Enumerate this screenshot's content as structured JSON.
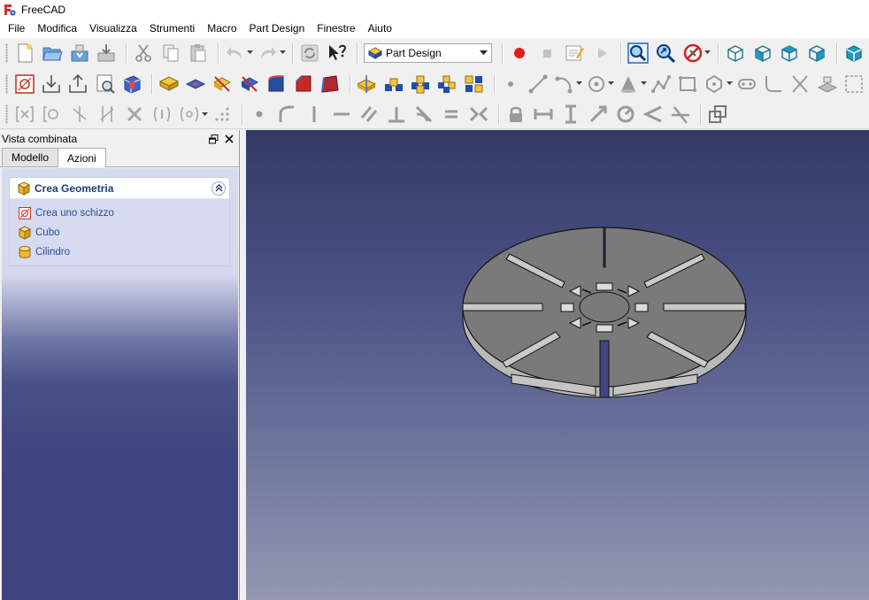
{
  "window": {
    "title": "FreeCAD"
  },
  "menu": [
    "File",
    "Modifica",
    "Visualizza",
    "Strumenti",
    "Macro",
    "Part Design",
    "Finestre",
    "Aiuto"
  ],
  "workbench": {
    "selected": "Part Design"
  },
  "combo_view": {
    "title": "Vista combinata",
    "tabs": [
      "Modello",
      "Azioni"
    ],
    "active_tab": "Azioni"
  },
  "tasks": {
    "group_title": "Crea Geometria",
    "items": [
      "Crea uno schizzo",
      "Cubo",
      "Cilindro"
    ]
  },
  "colors": {
    "accent": "#1f3c78",
    "viewport_top": "#333a66",
    "viewport_bottom": "#9498b2",
    "part_face": "#7a7a7a",
    "part_side": "#b9b9b9"
  },
  "toolbar_icons": {
    "row1": [
      "new-icon",
      "open-icon",
      "save-icon",
      "save-as-icon",
      "cut-icon",
      "copy-icon",
      "paste-icon",
      "undo-icon",
      "redo-icon",
      "refresh-icon",
      "whats-this-icon",
      "record-macro-icon",
      "stop-macro-icon",
      "edit-macro-icon",
      "run-macro-icon",
      "fit-all-icon",
      "fit-selection-icon",
      "draw-style-icon",
      "isometric-view-icon",
      "front-view-icon",
      "top-view-icon",
      "right-view-icon",
      "rear-view-icon"
    ],
    "row2": [
      "new-sketch-icon",
      "attach-sketch-icon",
      "close-sketch-icon",
      "view-sketch-icon",
      "view-section-icon",
      "pad-icon",
      "pocket-icon",
      "revolve-icon",
      "groove-icon",
      "fillet-icon",
      "chamfer-icon",
      "draft-icon",
      "mirror-icon",
      "linear-pattern-icon",
      "polar-pattern-icon",
      "multi-transform-icon",
      "point-icon",
      "line-icon",
      "arc-icon",
      "circle-icon",
      "conic-icon",
      "polyline-icon",
      "rectangle-icon",
      "polygon-icon",
      "slot-icon",
      "fillet-sketch-icon",
      "trim-icon",
      "external-geometry-icon",
      "construction-mode-icon"
    ],
    "row3": [
      "select-constraints-icon",
      "select-origin-icon",
      "select-vertical-axis-icon",
      "select-horizontal-axis-icon",
      "select-redundant-icon",
      "select-conflicting-icon",
      "select-elements-icon",
      "grid-points-icon",
      "constrain-coincident-icon",
      "constrain-point-on-object-icon",
      "constrain-vertical-icon",
      "constrain-horizontal-icon",
      "constrain-parallel-icon",
      "constrain-perpendicular-icon",
      "constrain-tangent-icon",
      "constrain-equal-icon",
      "constrain-symmetric-icon",
      "constrain-lock-icon",
      "constrain-horizontal-distance-icon",
      "constrain-vertical-distance-icon",
      "constrain-distance-icon",
      "constrain-radius-icon",
      "constrain-angle-icon",
      "constrain-snell-icon",
      "constrain-internal-alignment-icon"
    ]
  }
}
